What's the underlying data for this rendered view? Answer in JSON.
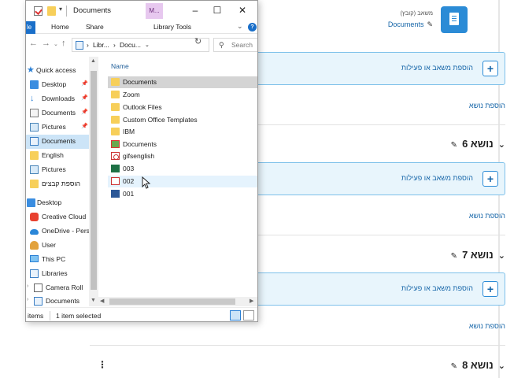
{
  "web": {
    "resource": {
      "type_label": "משאב (קובץ)",
      "name": "Documents"
    },
    "add_activity_label": "הוספת משאב או פעילות",
    "add_topic_label": "הוספת נושא",
    "topics": [
      {
        "title": "נושא 6"
      },
      {
        "title": "נושא 7"
      },
      {
        "title": "נושא 8"
      }
    ]
  },
  "explorer": {
    "title": "Documents",
    "context_tab": "M...",
    "ribbon_tabs": {
      "file": "le",
      "home": "Home",
      "share": "Share",
      "library_tools": "Library Tools"
    },
    "address": {
      "seg1": "Libr...",
      "seg2": "Docu..."
    },
    "search_placeholder": "Search",
    "nav": [
      {
        "label": "Quick access"
      },
      {
        "label": "Desktop"
      },
      {
        "label": "Downloads"
      },
      {
        "label": "Documents"
      },
      {
        "label": "Pictures"
      },
      {
        "label": "Documents"
      },
      {
        "label": "English"
      },
      {
        "label": "Pictures"
      },
      {
        "label": "הוספת קבצים"
      },
      {
        "label": "Desktop"
      },
      {
        "label": "Creative Cloud"
      },
      {
        "label": "OneDrive - Pers"
      },
      {
        "label": "User"
      },
      {
        "label": "This PC"
      },
      {
        "label": "Libraries"
      },
      {
        "label": "Camera Roll"
      },
      {
        "label": "Documents"
      }
    ],
    "column_name": "Name",
    "files": [
      {
        "name": "Documents"
      },
      {
        "name": "Zoom"
      },
      {
        "name": "Outlook Files"
      },
      {
        "name": "Custom Office Templates"
      },
      {
        "name": "IBM"
      },
      {
        "name": "Documents"
      },
      {
        "name": "gifsenglish"
      },
      {
        "name": "003"
      },
      {
        "name": "002"
      },
      {
        "name": "001"
      }
    ],
    "status": {
      "items": "items",
      "selected": "1 item selected"
    }
  },
  "colors": {
    "accent": "#2b8bd6",
    "link": "#1565a8",
    "box_bg": "#e8f5fc",
    "selection": "#cce4f7"
  }
}
